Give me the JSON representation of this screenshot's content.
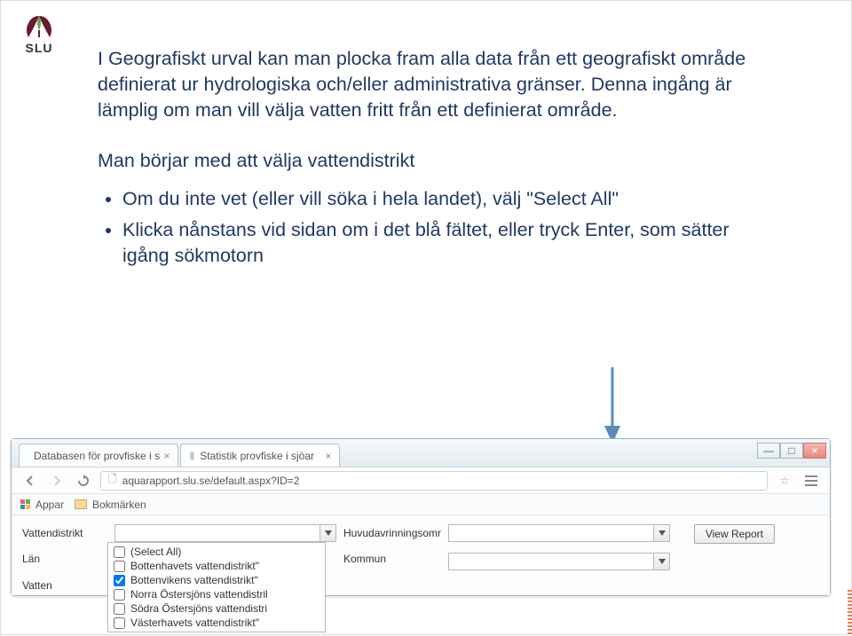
{
  "logo": {
    "text": "SLU"
  },
  "para1": "I Geografiskt urval kan man plocka fram alla data från ett geografiskt område definierat ur hydrologiska och/eller administrativa gränser. Denna ingång är lämplig om man vill välja vatten fritt från ett definierat område.",
  "para2": "Man börjar med att välja vattendistrikt",
  "bullets": [
    "Om du inte vet (eller vill söka i hela landet), välj \"Select All\"",
    "Klicka nånstans vid sidan om i det blå fältet, eller tryck Enter, som sätter igång sökmotorn"
  ],
  "tabs": [
    {
      "label": "Databasen för provfiske i s"
    },
    {
      "label": "Statistik provfiske i sjöar"
    }
  ],
  "url": "aquarapport.slu.se/default.aspx?ID=2",
  "bookbar": {
    "apps": "Appar",
    "bookmarks": "Bokmärken"
  },
  "labels": {
    "vattendistrikt": "Vattendistrikt",
    "huvudavrinningsomr": "Huvudavrinningsomr",
    "lan": "Län",
    "kommun": "Kommun",
    "vatten": "Vatten"
  },
  "view_report": "View Report",
  "dropdown_options": [
    {
      "label": "(Select All)",
      "checked": false
    },
    {
      "label": "Bottenhavets vattendistrikt\"",
      "checked": false
    },
    {
      "label": "Bottenvikens vattendistrikt\"",
      "checked": true
    },
    {
      "label": "Norra Östersjöns vattendistril",
      "checked": false
    },
    {
      "label": "Södra Östersjöns vattendistri",
      "checked": false
    },
    {
      "label": "Västerhavets vattendistrikt\"",
      "checked": false
    }
  ]
}
